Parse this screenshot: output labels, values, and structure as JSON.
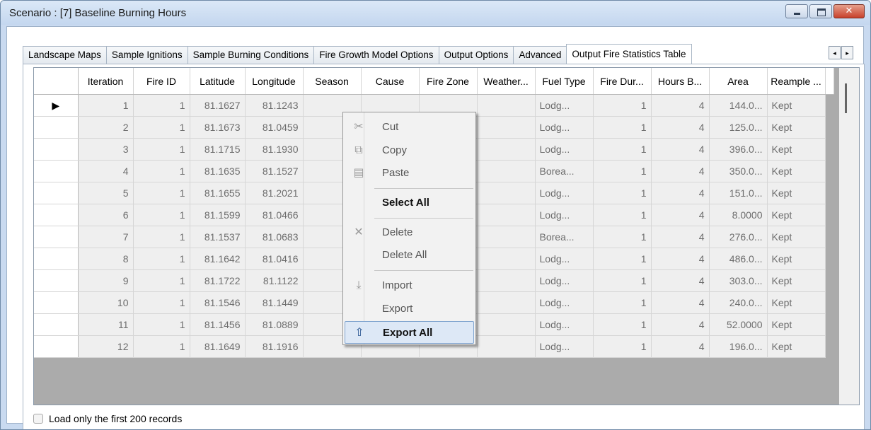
{
  "window": {
    "title": "Scenario : [7] Baseline Burning Hours",
    "minimize_icon": "minimize-icon",
    "maximize_icon": "maximize-icon",
    "close_icon": "close-icon",
    "close_glyph": "✕"
  },
  "tabs": [
    {
      "label": "Landscape Maps"
    },
    {
      "label": "Sample Ignitions"
    },
    {
      "label": "Sample Burning Conditions"
    },
    {
      "label": "Fire Growth Model Options"
    },
    {
      "label": "Output Options"
    },
    {
      "label": "Advanced"
    },
    {
      "label": "Output Fire Statistics Table",
      "active": true
    }
  ],
  "tab_scroll": {
    "left": "◂",
    "right": "▸"
  },
  "grid": {
    "columns": [
      "Iteration",
      "Fire ID",
      "Latitude",
      "Longitude",
      "Season",
      "Cause",
      "Fire Zone",
      "Weather...",
      "Fuel Type",
      "Fire Dur...",
      "Hours B...",
      "Area",
      "Reample ..."
    ],
    "current_row_marker": "▶",
    "rows": [
      [
        "1",
        "1",
        "81.1627",
        "81.1243",
        "",
        "",
        "",
        "",
        "Lodg...",
        "1",
        "4",
        "144.0...",
        "Kept"
      ],
      [
        "2",
        "1",
        "81.1673",
        "81.0459",
        "",
        "",
        "",
        "",
        "Lodg...",
        "1",
        "4",
        "125.0...",
        "Kept"
      ],
      [
        "3",
        "1",
        "81.1715",
        "81.1930",
        "",
        "",
        "",
        "",
        "Lodg...",
        "1",
        "4",
        "396.0...",
        "Kept"
      ],
      [
        "4",
        "1",
        "81.1635",
        "81.1527",
        "",
        "",
        "",
        "",
        "Borea...",
        "1",
        "4",
        "350.0...",
        "Kept"
      ],
      [
        "5",
        "1",
        "81.1655",
        "81.2021",
        "",
        "",
        "",
        "",
        "Lodg...",
        "1",
        "4",
        "151.0...",
        "Kept"
      ],
      [
        "6",
        "1",
        "81.1599",
        "81.0466",
        "",
        "",
        "",
        "",
        "Lodg...",
        "1",
        "4",
        "8.0000",
        "Kept"
      ],
      [
        "7",
        "1",
        "81.1537",
        "81.0683",
        "",
        "",
        "",
        "",
        "Borea...",
        "1",
        "4",
        "276.0...",
        "Kept"
      ],
      [
        "8",
        "1",
        "81.1642",
        "81.0416",
        "",
        "",
        "",
        "",
        "Lodg...",
        "1",
        "4",
        "486.0...",
        "Kept"
      ],
      [
        "9",
        "1",
        "81.1722",
        "81.1122",
        "",
        "",
        "",
        "",
        "Lodg...",
        "1",
        "4",
        "303.0...",
        "Kept"
      ],
      [
        "10",
        "1",
        "81.1546",
        "81.1449",
        "",
        "",
        "",
        "",
        "Lodg...",
        "1",
        "4",
        "240.0...",
        "Kept"
      ],
      [
        "11",
        "1",
        "81.1456",
        "81.0889",
        "",
        "",
        "",
        "",
        "Lodg...",
        "1",
        "4",
        "52.0000",
        "Kept"
      ],
      [
        "12",
        "1",
        "81.1649",
        "81.1916",
        "",
        "",
        "",
        "",
        "Lodg...",
        "1",
        "4",
        "196.0...",
        "Kept"
      ]
    ]
  },
  "options": {
    "load_first_label": "Load only the first 200 records",
    "load_first_checked": false
  },
  "context_menu": {
    "cut": {
      "label": "Cut",
      "icon": "cut-icon",
      "glyph": "✂"
    },
    "copy": {
      "label": "Copy",
      "icon": "copy-icon",
      "glyph": "⧉"
    },
    "paste": {
      "label": "Paste",
      "icon": "paste-icon",
      "glyph": "▤"
    },
    "select_all": {
      "label": "Select All"
    },
    "delete": {
      "label": "Delete",
      "icon": "delete-icon",
      "glyph": "✕"
    },
    "delete_all": {
      "label": "Delete All"
    },
    "import": {
      "label": "Import",
      "icon": "import-icon",
      "glyph": "⤓"
    },
    "export": {
      "label": "Export"
    },
    "export_all": {
      "label": "Export All",
      "icon": "export-icon",
      "glyph": "⇧",
      "highlighted": true
    }
  }
}
